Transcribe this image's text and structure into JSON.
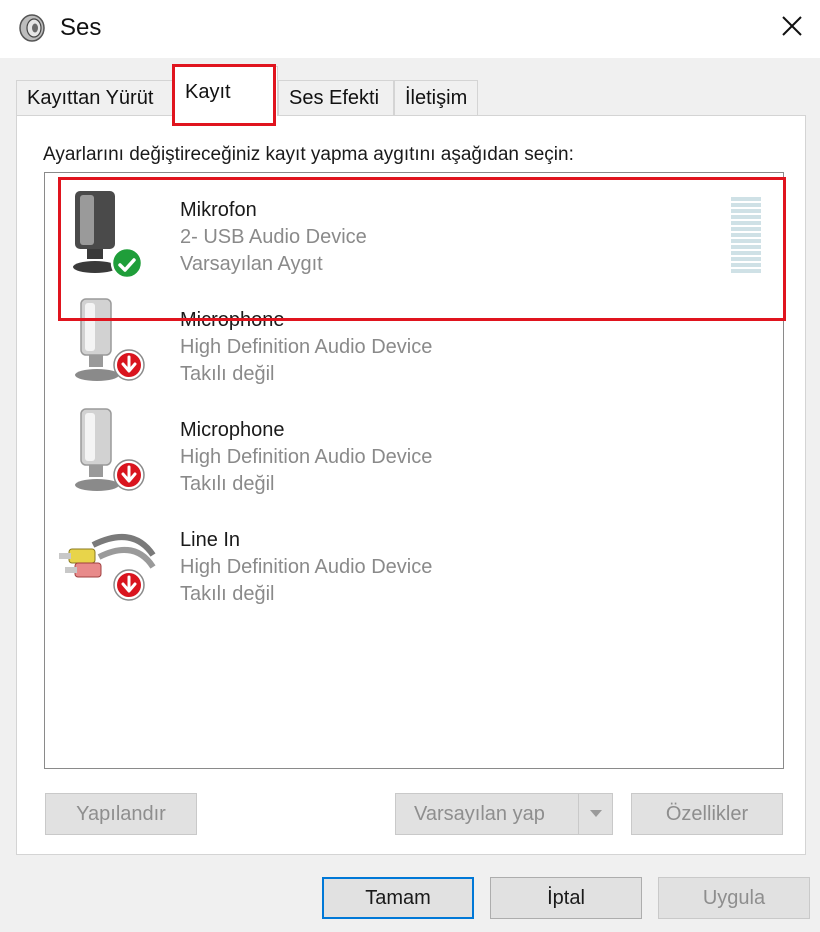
{
  "window": {
    "title": "Ses",
    "close_glyph": "✕",
    "icon": "speaker-icon"
  },
  "tabs": [
    {
      "label": "Kayıttan Yürüt"
    },
    {
      "label": "Kayıt",
      "active": true
    },
    {
      "label": "Ses Efekti"
    },
    {
      "label": "İletişim"
    }
  ],
  "instruction": "Ayarlarını değiştireceğiniz kayıt yapma aygıtını aşağıdan seçin:",
  "devices": [
    {
      "name": "Mikrofon",
      "description": "2- USB Audio Device",
      "status": "Varsayılan Aygıt",
      "icon": "usb-microphone-icon",
      "badge": "default-check-icon",
      "selected": true
    },
    {
      "name": "Microphone",
      "description": "High Definition Audio Device",
      "status": "Takılı değil",
      "icon": "microphone-icon",
      "badge": "unplugged-arrow-icon"
    },
    {
      "name": "Microphone",
      "description": "High Definition Audio Device",
      "status": "Takılı değil",
      "icon": "microphone-icon",
      "badge": "unplugged-arrow-icon"
    },
    {
      "name": "Line In",
      "description": "High Definition Audio Device",
      "status": "Takılı değil",
      "icon": "line-in-cable-icon",
      "badge": "unplugged-arrow-icon"
    }
  ],
  "panel_buttons": {
    "configure": "Yapılandır",
    "set_default": "Varsayılan yap",
    "properties": "Özellikler"
  },
  "dialog_buttons": {
    "ok": "Tamam",
    "cancel": "İptal",
    "apply": "Uygula"
  },
  "colors": {
    "highlight": "#e0141e",
    "check_badge": "#1f9e3a",
    "unplugged_badge": "#d9141e",
    "default_button_border": "#0078d7",
    "level_meter": "#cfe1e6"
  }
}
